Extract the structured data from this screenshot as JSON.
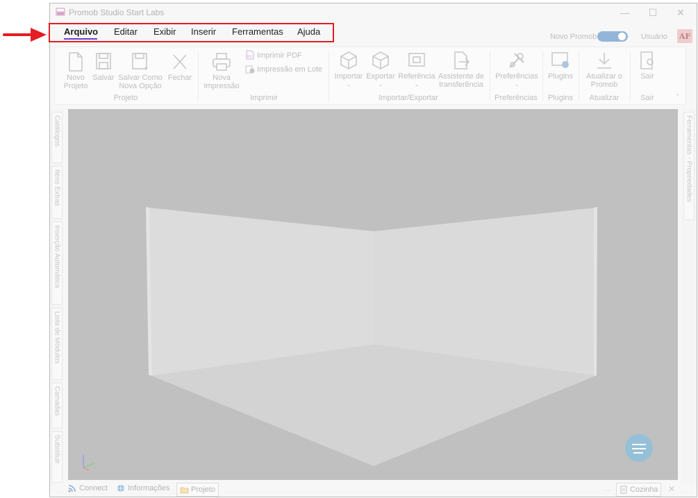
{
  "window": {
    "title": "Promob Studio Start Labs"
  },
  "menu": {
    "items": [
      "Arquivo",
      "Editar",
      "Exibir",
      "Inserir",
      "Ferramentas",
      "Ajuda"
    ],
    "active": "Arquivo",
    "novo_promob_label": "Novo Promob",
    "novo_promob_on": true,
    "user_label": "Usuário",
    "avatar_initials": "AF"
  },
  "ribbon": {
    "novo_projeto": "Novo Projeto",
    "salvar": "Salvar",
    "salvar_como": "Salvar Como Nova Opção",
    "fechar": "Fechar",
    "group_projeto": "Projeto",
    "nova_impressao": "Nova Impressão",
    "imprimir_pdf": "Imprimir PDF",
    "impressao_lote": "Impressão em Lote",
    "group_imprimir": "Imprimir",
    "importar": "Importar",
    "exportar": "Exportar",
    "referencia": "Referência",
    "assistente": "Assistente de transferência",
    "group_importar": "Importar/Exportar",
    "preferencias": "Preferências",
    "group_preferencias": "Preferências",
    "plugins": "Plugins",
    "group_plugins": "Plugins",
    "atualizar": "Atualizar o Promob",
    "group_atualizar": "Atualizar",
    "sair": "Sair",
    "group_sair": "Sair"
  },
  "left_tabs": [
    "Catálogos",
    "Itens Extras",
    "Inserção Automática",
    "Lista de Módulos",
    "Camadas",
    "Substituir"
  ],
  "right_tabs": [
    "Ferramentas - Propriedades"
  ],
  "status": {
    "connect": "Connect",
    "informacoes": "Informações",
    "projeto": "Projeto",
    "cozinha": "Cozinha"
  },
  "colors": {
    "highlight": "#e51d24",
    "active_underline": "#6b3fd1",
    "toggle": "#5b8ec7"
  }
}
